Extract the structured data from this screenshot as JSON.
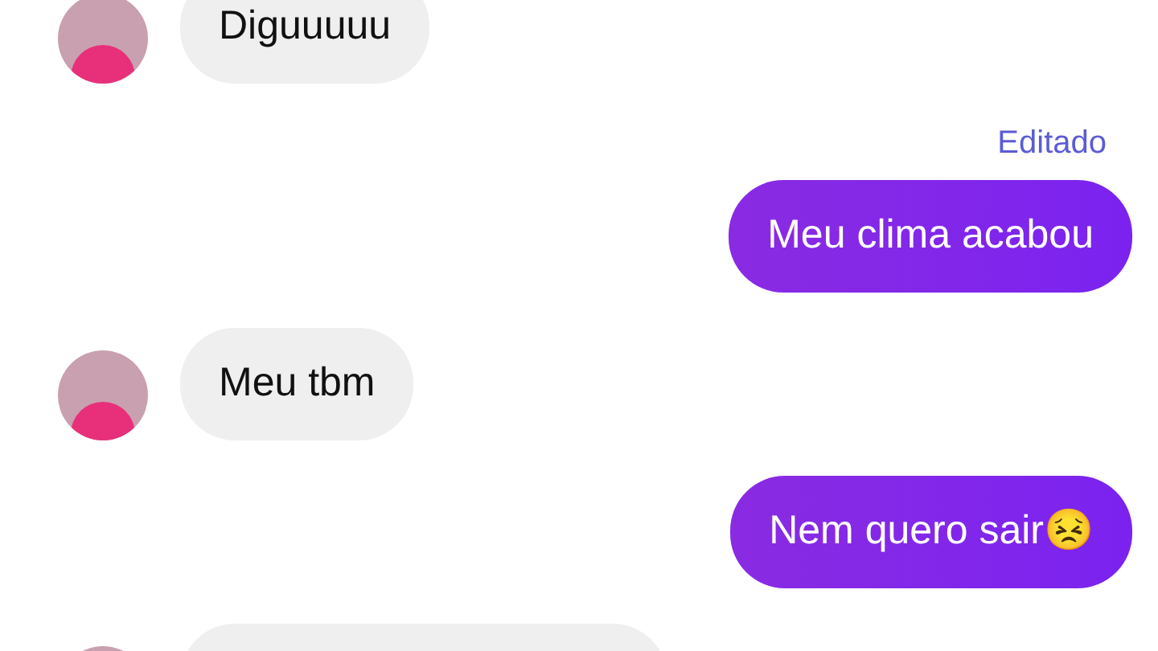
{
  "messages": [
    {
      "kind": "received",
      "text": "Diguuuuu"
    },
    {
      "kind": "sent",
      "text": "Meu clima acabou",
      "edited_label": "Editado"
    },
    {
      "kind": "received",
      "text": "Meu tbm"
    },
    {
      "kind": "sent",
      "text": "Nem quero sair😣"
    },
    {
      "kind": "received"
    }
  ]
}
